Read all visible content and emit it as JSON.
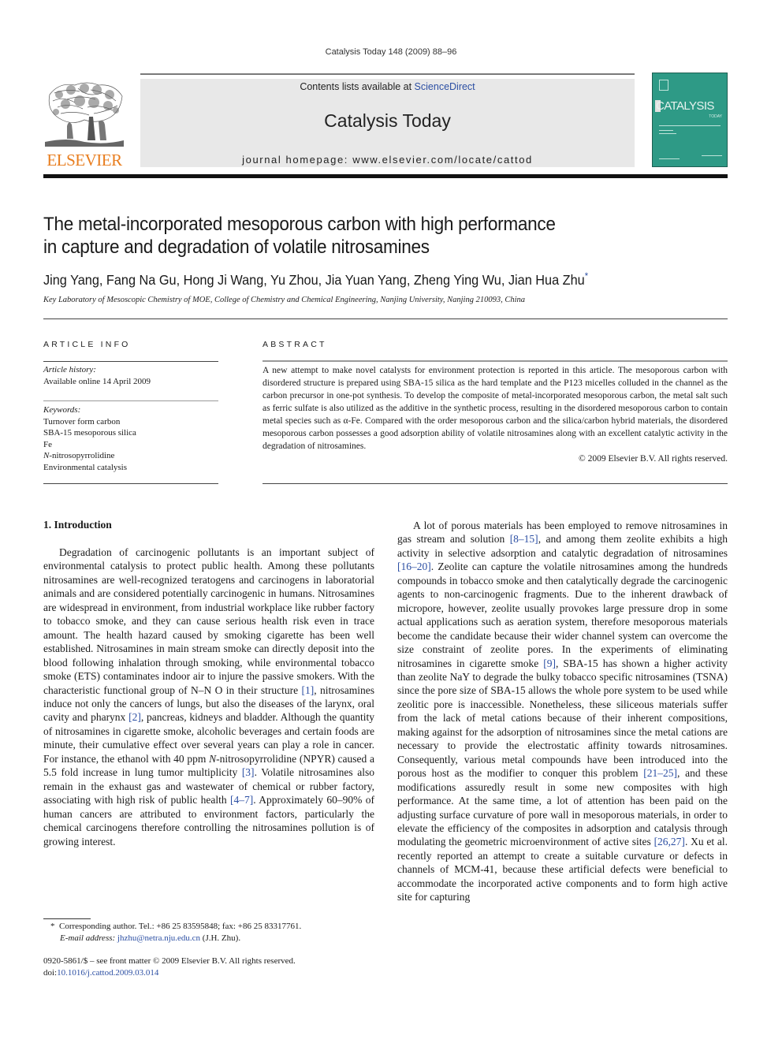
{
  "running_head": "Catalysis Today 148 (2009) 88–96",
  "header": {
    "publisher_logo_text": "ELSEVIER",
    "contents_prefix": "Contents lists available at ",
    "contents_link": "ScienceDirect",
    "journal_name": "Catalysis Today",
    "homepage": "journal homepage: www.elsevier.com/locate/cattod",
    "cover_title": "CATALYSIS",
    "cover_subtitle": "TODAY"
  },
  "colors": {
    "link": "#2c4fa3",
    "elsevier_orange": "#e87d1e",
    "cover_teal": "#2e9a86",
    "header_band": "#e8e8e8"
  },
  "article": {
    "title_line1": "The metal-incorporated mesoporous carbon with high performance",
    "title_line2": "in capture and degradation of volatile nitrosamines",
    "authors": "Jing Yang, Fang Na Gu, Hong Ji Wang, Yu Zhou, Jia Yuan Yang, Zheng Ying Wu, Jian Hua Zhu",
    "corresponding_marker": "*",
    "affiliation": "Key Laboratory of Mesoscopic Chemistry of MOE, College of Chemistry and Chemical Engineering, Nanjing University, Nanjing 210093, China"
  },
  "article_info": {
    "label": "ARTICLE INFO",
    "history_label": "Article history:",
    "history_value": "Available online 14 April 2009",
    "keywords_label": "Keywords:",
    "keywords": [
      {
        "prefix": "",
        "text": "Turnover form carbon"
      },
      {
        "prefix": "",
        "text": "SBA-15 mesoporous silica"
      },
      {
        "prefix": "",
        "text": "Fe"
      },
      {
        "prefix": "N",
        "text": "-nitrosopyrrolidine"
      },
      {
        "prefix": "",
        "text": "Environmental catalysis"
      }
    ]
  },
  "abstract": {
    "label": "ABSTRACT",
    "text": "A new attempt to make novel catalysts for environment protection is reported in this article. The mesoporous carbon with disordered structure is prepared using SBA-15 silica as the hard template and the P123 micelles colluded in the channel as the carbon precursor in one-pot synthesis. To develop the composite of metal-incorporated mesoporous carbon, the metal salt such as ferric sulfate is also utilized as the additive in the synthetic process, resulting in the disordered mesoporous carbon to contain metal species such as α-Fe. Compared with the order mesoporous carbon and the silica/carbon hybrid materials, the disordered mesoporous carbon possesses a good adsorption ability of volatile nitrosamines along with an excellent catalytic activity in the degradation of nitrosamines.",
    "copyright": "© 2009 Elsevier B.V. All rights reserved."
  },
  "introduction": {
    "heading": "1.  Introduction",
    "left_column": {
      "s1": "Degradation of carcinogenic pollutants is an important subject of environmental catalysis to protect public health. Among these pollutants nitrosamines are well-recognized teratogens and carcinogens in laboratorial animals and are considered potentially carcinogenic in humans. Nitrosamines are widespread in environment, from industrial workplace like rubber factory to tobacco smoke, and they can cause serious health risk even in trace amount. The health hazard caused by smoking cigarette has been well established. Nitrosamines in main stream smoke can directly deposit into the blood following inhalation through smoking, while environmental tobacco smoke (ETS) contaminates indoor air to injure the passive smokers. With the characteristic functional group of N–N O in their structure ",
      "r1": "[1]",
      "s2": ", nitrosamines induce not only the cancers of lungs, but also the diseases of the larynx, oral cavity and pharynx ",
      "r2": "[2]",
      "s3": ", pancreas, kidneys and bladder. Although the quantity of nitrosamines in cigarette smoke, alcoholic beverages and certain foods are minute, their cumulative effect over several years can play a role in cancer. For instance, the ethanol with 40 ppm ",
      "s3_italic": "N",
      "s4": "-nitrosopyrrolidine (NPYR) caused a 5.5 fold increase in lung tumor multiplicity ",
      "r3": "[3]",
      "s5": ". Volatile nitrosamines also remain in the exhaust gas and wastewater of chemical or rubber factory, associating with high risk of public health ",
      "r4": "[4–7]",
      "s6": ". Approximately 60–90% of human cancers are attributed to environment factors, particularly the chemical carcinogens therefore controlling the nitrosamines pollution is of growing interest."
    },
    "right_column": {
      "s1": "A lot of porous materials has been employed to remove nitrosamines in gas stream and solution ",
      "r1": "[8–15]",
      "s2": ", and among them zeolite exhibits a high activity in selective adsorption and catalytic degradation of nitrosamines ",
      "r2": "[16–20]",
      "s3": ". Zeolite can capture the volatile nitrosamines among the hundreds compounds in tobacco smoke and then catalytically degrade the carcinogenic agents to non-carcinogenic fragments. Due to the inherent drawback of micropore, however, zeolite usually provokes large pressure drop in some actual applications such as aeration system, therefore mesoporous materials become the candidate because their wider channel system can overcome the size constraint of zeolite pores. In the experiments of eliminating nitrosamines in cigarette smoke ",
      "r3": "[9]",
      "s4": ", SBA-15 has shown a higher activity than zeolite NaY to degrade the bulky tobacco specific nitrosamines (TSNA) since the pore size of SBA-15 allows the whole pore system to be used while zeolitic pore is inaccessible. Nonetheless, these siliceous materials suffer from the lack of metal cations because of their inherent compositions, making against for the adsorption of nitrosamines since the metal cations are necessary to provide the electrostatic affinity towards nitrosamines. Consequently, various metal compounds have been introduced into the porous host as the modifier to conquer this problem ",
      "r4": "[21–25]",
      "s5": ", and these modifications assuredly result in some new composites with high performance. At the same time, a lot of attention has been paid on the adjusting surface curvature of pore wall in mesoporous materials, in order to elevate the efficiency of the composites in adsorption and catalysis through modulating the geometric microenvironment of active sites ",
      "r5": "[26,27]",
      "s6": ". Xu et al. recently reported an attempt to create a suitable curvature or defects in channels of MCM-41, because these artificial defects were beneficial to accommodate the incorporated active components and to form high active site for capturing"
    }
  },
  "footnotes": {
    "marker": "*",
    "corresponding": "Corresponding author. Tel.: +86 25 83595848; fax: +86 25 83317761.",
    "email_label": "E-mail address:",
    "email": "jhzhu@netra.nju.edu.cn",
    "email_suffix": " (J.H. Zhu).",
    "front_matter": "0920-5861/$ – see front matter © 2009 Elsevier B.V. All rights reserved.",
    "doi_prefix": "doi:",
    "doi": "10.1016/j.cattod.2009.03.014"
  }
}
